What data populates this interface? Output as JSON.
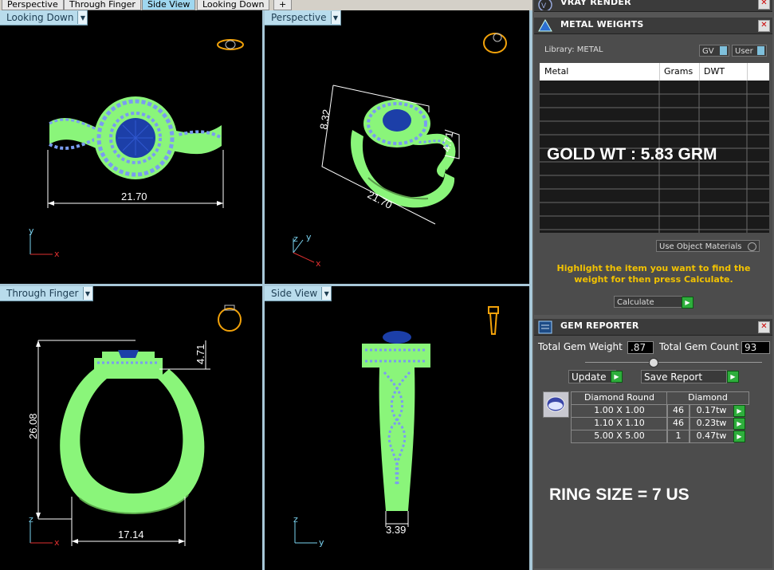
{
  "tabs": [
    "Perspective",
    "Through Finger",
    "Side View",
    "Looking Down",
    "+"
  ],
  "viewports": {
    "top_left": {
      "label": "Looking Down",
      "dimension": "21.70"
    },
    "top_right": {
      "label": "Perspective",
      "dim_a": "8.32",
      "dim_b": "4.71",
      "dim_c": "21.70"
    },
    "bottom_left": {
      "label": "Through Finger",
      "dim_height": "26.08",
      "dim_top": "4.71",
      "dim_width": "17.14"
    },
    "bottom_right": {
      "label": "Side View",
      "dimension": "3.39"
    }
  },
  "axes": {
    "x": "x",
    "y": "y",
    "z": "z"
  },
  "vray": {
    "title": "VRAY RENDER"
  },
  "metal": {
    "title": "METAL WEIGHTS",
    "library": "Library: METAL",
    "gv": "GV",
    "user": "User",
    "columns": [
      "Metal",
      "Grams",
      "DWT"
    ],
    "overlay": "GOLD WT : 5.83 GRM",
    "use_object": "Use Object Materials",
    "hint": "Highlight the item you want to find the weight for then press Calculate.",
    "calculate": "Calculate"
  },
  "gem": {
    "title": "GEM REPORTER",
    "total_weight_label": "Total Gem Weight",
    "total_weight": ".87",
    "total_count_label": "Total Gem Count",
    "total_count": "93",
    "update": "Update",
    "save": "Save Report",
    "col_type": "Diamond Round",
    "col_mat": "Diamond",
    "rows": [
      {
        "size": "1.00 X 1.00",
        "count": "46",
        "tw": "0.17tw"
      },
      {
        "size": "1.10 X 1.10",
        "count": "46",
        "tw": "0.23tw"
      },
      {
        "size": "5.00 X 5.00",
        "count": "1",
        "tw": "0.47tw"
      }
    ],
    "ring_size": "RING SIZE = 7 US"
  },
  "colors": {
    "metal": "#8af57a",
    "gem": "#1c3fa8",
    "accent": "#f2c200"
  }
}
